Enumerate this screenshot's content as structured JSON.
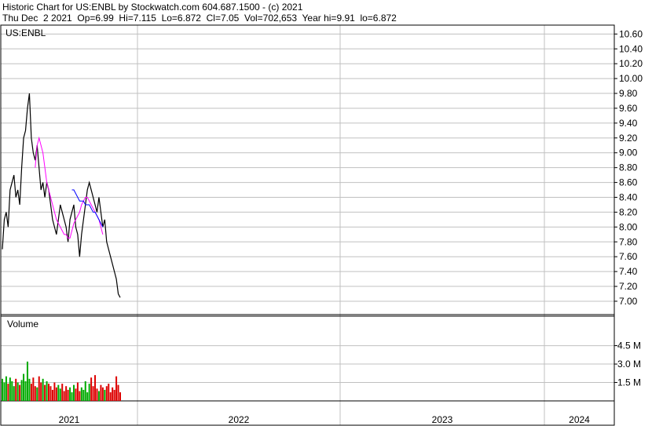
{
  "header": {
    "line1": "Historic Chart for US:ENBL by Stockwatch.com 604.687.1500 - (c) 2021",
    "line2": "Thu Dec  2 2021  Op=6.99  Hi=7.115  Lo=6.872  Cl=7.05  Vol=702,653  Year hi=9.91  lo=6.872"
  },
  "chart_data": {
    "type": "line",
    "title": "US:ENBL",
    "volume_title": "Volume",
    "price_axis": {
      "ylim": [
        6.82,
        10.72
      ],
      "ticks": [
        "10.60",
        "10.40",
        "10.20",
        "10.00",
        "9.80",
        "9.60",
        "9.40",
        "9.20",
        "9.00",
        "8.80",
        "8.60",
        "8.40",
        "8.20",
        "8.00",
        "7.80",
        "7.60",
        "7.40",
        "7.20",
        "7.00"
      ]
    },
    "volume_axis": {
      "ylim": [
        0,
        6.9
      ],
      "unit": "M",
      "ticks": [
        "4.5 M",
        "3.0 M",
        "1.5 M"
      ]
    },
    "x_axis": {
      "labels": [
        "2021",
        "2022",
        "2023",
        "2024"
      ]
    },
    "grid": true,
    "series": [
      {
        "role": "price",
        "values": [
          7.7,
          8.1,
          8.2,
          8.0,
          8.5,
          8.6,
          8.7,
          8.4,
          8.5,
          8.3,
          8.8,
          9.2,
          9.3,
          9.6,
          9.8,
          9.2,
          9.0,
          8.9,
          9.1,
          8.8,
          8.5,
          8.6,
          8.4,
          8.6,
          8.5,
          8.3,
          8.1,
          8.0,
          7.9,
          8.1,
          8.3,
          8.2,
          8.1,
          8.0,
          7.8,
          8.1,
          8.2,
          8.3,
          8.0,
          7.9,
          7.6,
          7.9,
          8.1,
          8.3,
          8.5,
          8.6,
          8.5,
          8.4,
          8.3,
          8.2,
          8.4,
          8.2,
          8.0,
          8.1,
          7.8,
          7.7,
          7.6,
          7.5,
          7.4,
          7.3,
          7.1,
          7.05
        ]
      },
      {
        "role": "moving-average-short",
        "values": [
          null,
          null,
          null,
          null,
          null,
          null,
          null,
          null,
          null,
          null,
          null,
          null,
          null,
          null,
          null,
          null,
          null,
          8.8,
          9.1,
          9.2,
          9.1,
          9.0,
          8.8,
          8.6,
          8.5,
          8.4,
          8.3,
          8.2,
          8.1,
          8.05,
          8.0,
          7.95,
          7.9,
          7.9,
          7.85,
          7.85,
          7.95,
          8.05,
          8.1,
          8.15,
          8.2,
          8.3,
          8.35,
          8.4,
          8.4,
          8.35,
          8.3,
          8.25,
          8.2,
          8.15,
          8.1,
          8.0,
          7.9
        ]
      },
      {
        "role": "moving-average-long",
        "values": [
          null,
          null,
          null,
          null,
          null,
          null,
          null,
          null,
          null,
          null,
          null,
          null,
          null,
          null,
          null,
          null,
          null,
          null,
          null,
          null,
          null,
          null,
          null,
          null,
          null,
          null,
          null,
          null,
          null,
          null,
          null,
          null,
          null,
          null,
          null,
          null,
          8.5,
          8.5,
          8.45,
          8.4,
          8.35,
          8.35,
          8.35,
          8.3,
          8.3,
          8.3,
          8.25,
          8.2,
          8.2,
          8.15,
          8.1,
          8.05,
          8.0
        ]
      },
      {
        "role": "volume",
        "values": [
          1.8,
          1.5,
          2.0,
          1.4,
          1.9,
          1.6,
          1.2,
          1.8,
          1.5,
          1.3,
          1.7,
          2.2,
          1.6,
          3.2,
          1.8,
          1.4,
          1.9,
          1.2,
          1.1,
          2.0,
          1.5,
          1.8,
          1.3,
          1.6,
          1.4,
          1.2,
          0.9,
          1.5,
          1.1,
          1.3,
          1.0,
          1.4,
          0.8,
          1.2,
          0.9,
          1.1,
          0.7,
          1.3,
          1.0,
          1.5,
          0.8,
          1.1,
          0.9,
          1.6,
          0.7,
          1.4,
          1.9,
          1.2,
          2.1,
          1.0,
          0.8,
          1.3,
          1.1,
          0.9,
          1.2,
          1.4,
          0.7,
          1.1,
          0.9,
          2.0,
          1.3,
          0.7
        ]
      }
    ]
  },
  "colors": {
    "grid": "#c0c0c0",
    "frame": "#000000",
    "price": "#000000",
    "ma_short": "#ff00ff",
    "ma_long": "#0000ff",
    "volume_up": "#00aa00",
    "volume_down": "#dd0000"
  }
}
